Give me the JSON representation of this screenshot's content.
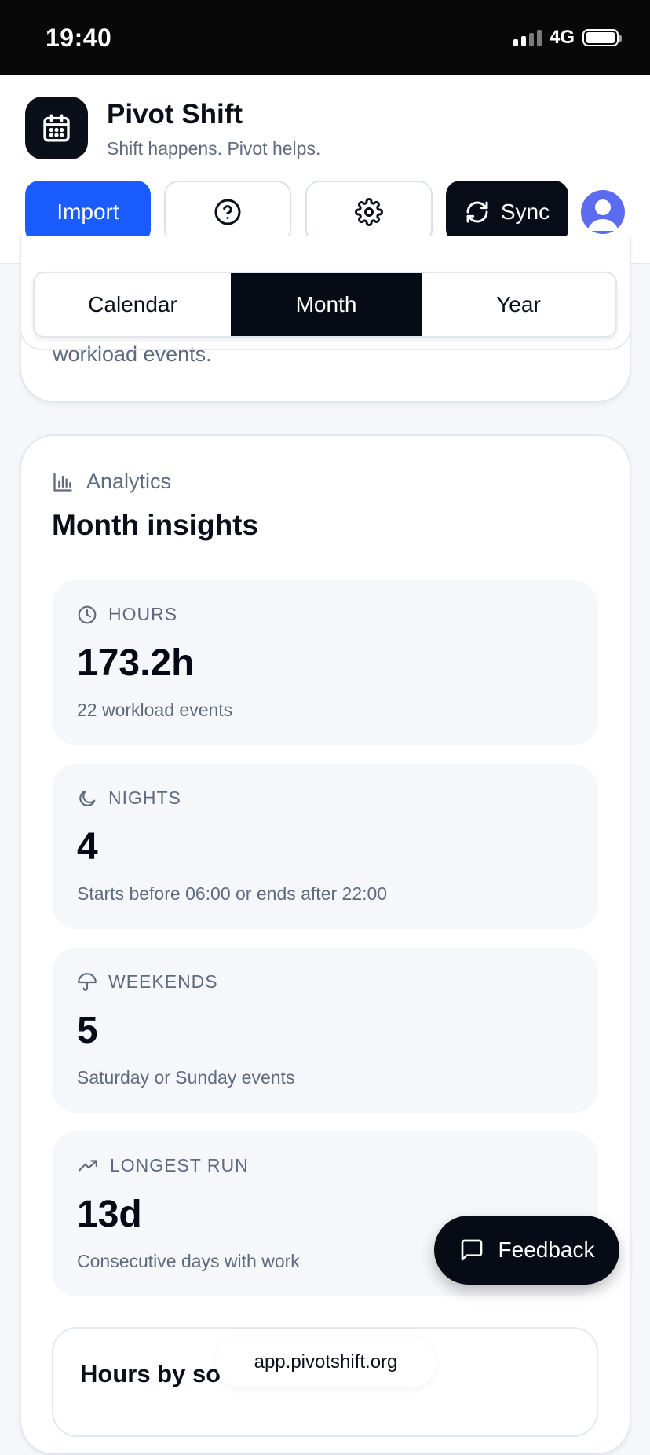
{
  "status_bar": {
    "time": "19:40",
    "network": "4G"
  },
  "app": {
    "title": "Pivot Shift",
    "subtitle": "Shift happens. Pivot helps."
  },
  "toolbar": {
    "import_label": "Import",
    "sync_label": "Sync"
  },
  "view_tabs": {
    "items": [
      "Calendar",
      "Month",
      "Year"
    ],
    "selected": "Month"
  },
  "top_card": {
    "partial_text": "workload events."
  },
  "analytics": {
    "eyebrow": "Analytics",
    "title": "Month insights",
    "stats": [
      {
        "label": "HOURS",
        "value": "173.2h",
        "desc": "22 workload events",
        "icon": "clock-icon"
      },
      {
        "label": "NIGHTS",
        "value": "4",
        "desc": "Starts before 06:00 or ends after 22:00",
        "icon": "moon-icon"
      },
      {
        "label": "WEEKENDS",
        "value": "5",
        "desc": "Saturday or Sunday events",
        "icon": "umbrella-icon"
      },
      {
        "label": "LONGEST RUN",
        "value": "13d",
        "desc": "Consecutive days with work",
        "icon": "trending-up-icon"
      }
    ]
  },
  "hours_by_source": {
    "title": "Hours by so"
  },
  "browser": {
    "url": "app.pivotshift.org"
  },
  "feedback": {
    "label": "Feedback"
  },
  "colors": {
    "primary": "#1a5cff",
    "dark": "#070b15",
    "muted": "#5f6b7d",
    "avatar": "#5b6cf0"
  }
}
